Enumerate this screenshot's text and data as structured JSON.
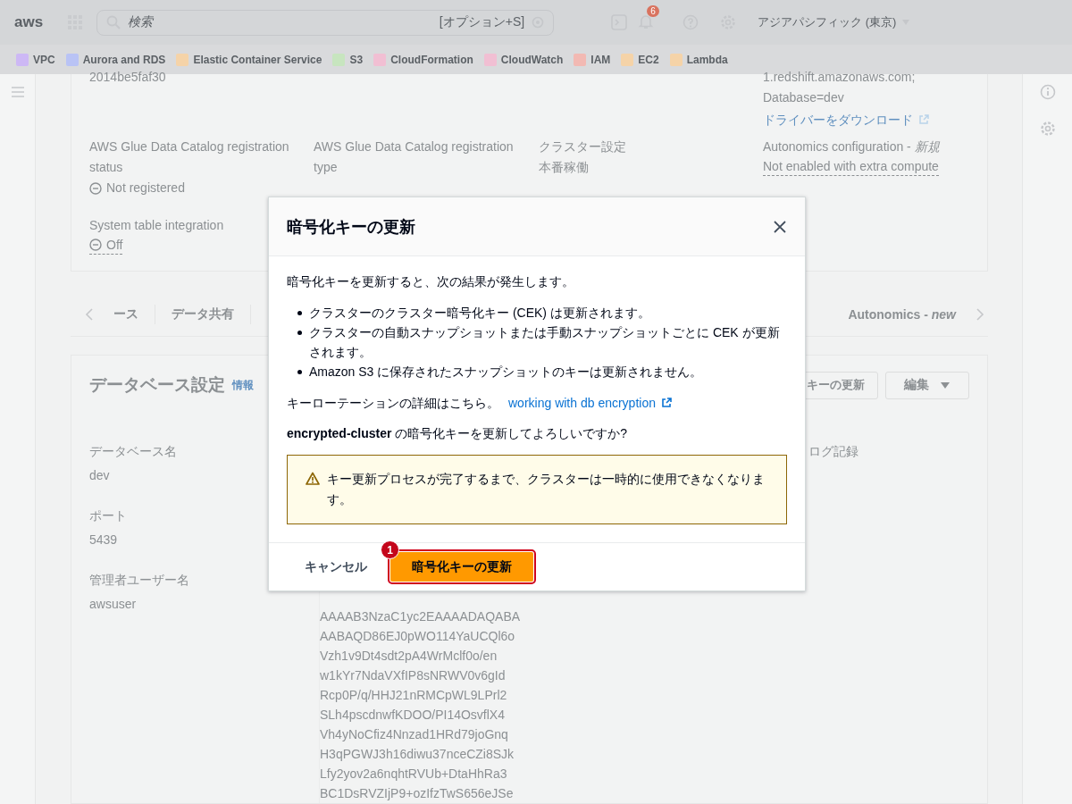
{
  "nav": {
    "logo": "aws",
    "search_placeholder": "検索",
    "shortcut": "[オプション+S]",
    "notifications": "6",
    "region": "アジアパシフィック (東京)"
  },
  "favorites": [
    {
      "label": "VPC",
      "color": "#cdb8f5"
    },
    {
      "label": "Aurora and RDS",
      "color": "#b9c3f5"
    },
    {
      "label": "Elastic Container Service",
      "color": "#f5d3a8"
    },
    {
      "label": "S3",
      "color": "#c7e5bf"
    },
    {
      "label": "CloudFormation",
      "color": "#f1bfd3"
    },
    {
      "label": "CloudWatch",
      "color": "#f1bfd3"
    },
    {
      "label": "IAM",
      "color": "#f2b9b3"
    },
    {
      "label": "EC2",
      "color": "#f5d3a8"
    },
    {
      "label": "Lambda",
      "color": "#f5d3a8"
    }
  ],
  "details": {
    "rows": [
      [
        {
          "value": "2014be5faf30"
        },
        {},
        {},
        {
          "lines": [
            "1.redshift.amazonaws.com;",
            "Database=dev"
          ],
          "link": "ドライバーをダウンロード"
        }
      ],
      [
        {
          "label": "AWS Glue Data Catalog registration status",
          "value": "Not registered",
          "kind": "status"
        },
        {
          "label": "AWS Glue Data Catalog registration type"
        },
        {
          "label": "クラスター設定",
          "value": "本番稼働"
        },
        {
          "label": "Autonomics configuration - *新規*",
          "value": "Not enabled with extra compute",
          "underline": true
        }
      ],
      [
        {
          "label": "System table integration",
          "value": "Off",
          "kind": "status",
          "underline": true
        },
        {},
        {},
        {}
      ]
    ]
  },
  "tabs_left": [
    {
      "label": "ース"
    },
    {
      "label": "データ共有"
    }
  ],
  "tabs_right": [
    {
      "label": "Autonomics - *new*"
    }
  ],
  "database_card": {
    "title": "データベース設定",
    "info": "情報",
    "buttons": [
      {
        "label": "キーの更新",
        "dropdown": false
      },
      {
        "label": "編集",
        "dropdown": true
      }
    ],
    "fields": [
      {
        "label": "データベース名",
        "value": "dev"
      },
      {
        "label": "ポート",
        "value": "5439"
      },
      {
        "label": "管理者ユーザー名",
        "value": "awsuser"
      }
    ],
    "key_lines": [
      "AAAAB3NzaC1yc2EAAAADAQABA",
      "AABAQD86EJ0pWO114YaUCQl6o",
      "Vzh1v9Dt4sdt2pA4WrMclf0o/en",
      "w1kYr7NdaVXfIP8sNRWV0v6gId",
      "Rcp0P/q/HHJ21nRMCpWL9LPrl2",
      "SLh4pscdnwfKDOO/PI14OsvflX4",
      "Vh4yNoCfiz4Nnzad1HRd79joGnq",
      "H3qPGWJ3h16diwu37nceCZi8SJk",
      "Lfy2yov2a6nqhtRVUb+DtaHhRa3",
      "BC1DsRVZIjP9+ozIfzTwS656eJSe"
    ],
    "column_3_label": "ログ記録"
  },
  "modal": {
    "title": "暗号化キーの更新",
    "intro": "暗号化キーを更新すると、次の結果が発生します。",
    "bullets": [
      "クラスターのクラスター暗号化キー (CEK) は更新されます。",
      "クラスターの自動スナップショットまたは手動スナップショットごとに CEK が更新されます。",
      "Amazon S3 に保存されたスナップショットのキーは更新されません。"
    ],
    "more_text": "キーローテーションの詳細はこちら。",
    "more_link": "working with db encryption",
    "question": "**encrypted-cluster** の暗号化キーを更新してよろしいですか?",
    "warning": "キー更新プロセスが完了するまで、クラスターは一時的に使用できなくなります。",
    "cancel": "キャンセル",
    "confirm": "暗号化キーの更新",
    "confirm_highlighted": true,
    "step_badge": "1"
  }
}
